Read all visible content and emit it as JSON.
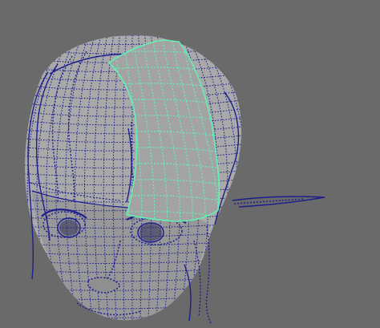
{
  "viewport": {
    "background": "#6a6a6a",
    "colors": {
      "mesh_fill": "#a8a8a8",
      "mesh_shade": "#8d8d8d",
      "wire": "#1d1f8c",
      "selection": "#64f0b4",
      "eye_dark": "#2b2b5a"
    },
    "objects": [
      {
        "name": "head-mesh",
        "state": "unselected-wireframe-on-shaded"
      },
      {
        "name": "hair-strands",
        "state": "unselected-wireframe"
      },
      {
        "name": "hair-card",
        "state": "selected"
      },
      {
        "name": "ear-spike",
        "state": "unselected-wireframe"
      }
    ]
  }
}
